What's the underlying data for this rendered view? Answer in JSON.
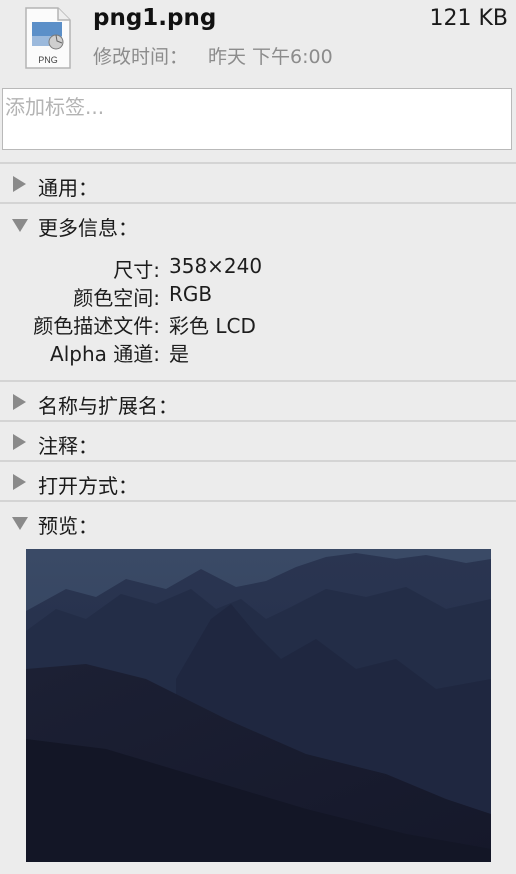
{
  "file": {
    "name": "png1.png",
    "size": "121 KB",
    "icon_label": "PNG",
    "modified_label": "修改时间：",
    "modified_value": "昨天 下午6:00"
  },
  "tags": {
    "placeholder": "添加标签..."
  },
  "sections": {
    "general": "通用：",
    "more_info": "更多信息：",
    "name_ext": "名称与扩展名：",
    "comments": "注释：",
    "open_with": "打开方式：",
    "preview": "预览："
  },
  "more_info": [
    {
      "key": "尺寸:",
      "value": "358×240"
    },
    {
      "key": "颜色空间:",
      "value": "RGB"
    },
    {
      "key": "颜色描述文件:",
      "value": "彩色 LCD"
    },
    {
      "key": "Alpha 通道:",
      "value": "是"
    }
  ],
  "colors": {
    "triangle": "#8a8a8a",
    "placeholder": "#b3b3b3",
    "secondary_text": "#8c8c8c"
  }
}
